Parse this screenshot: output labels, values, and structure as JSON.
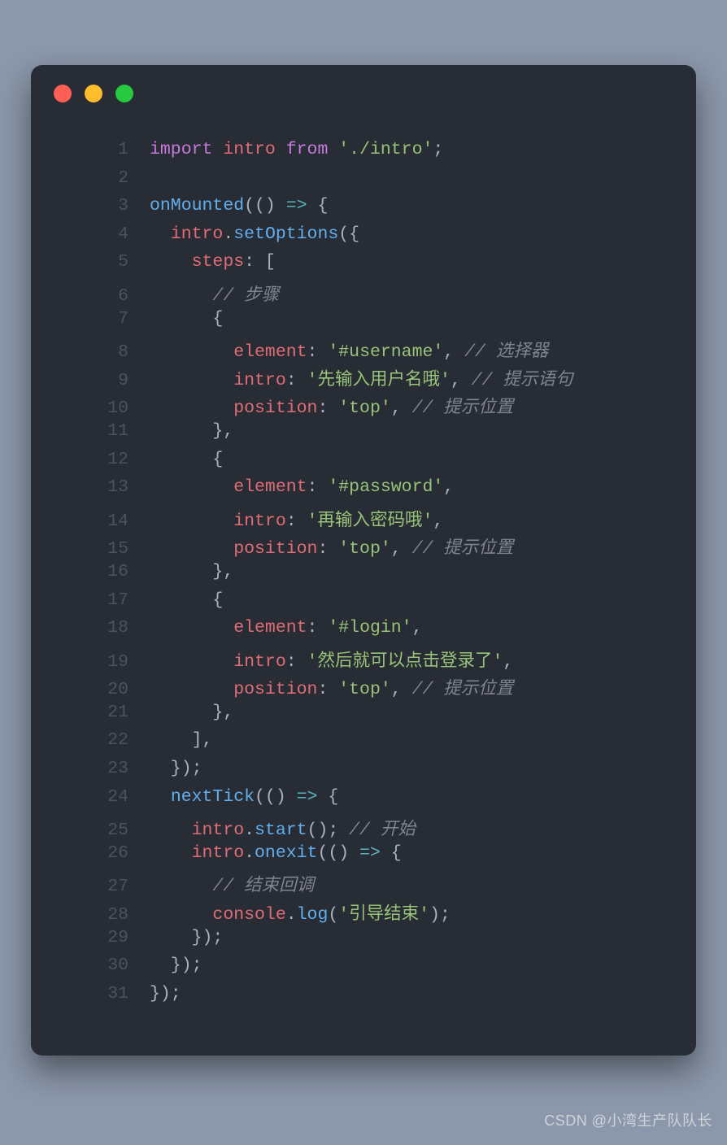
{
  "dots": {
    "red": "#ff5f56",
    "yellow": "#ffbd2e",
    "green": "#27c93f"
  },
  "watermark": "CSDN @小湾生产队队长",
  "lines": [
    {
      "n": "1",
      "seg": [
        [
          "kw",
          "import"
        ],
        [
          "pn",
          " "
        ],
        [
          "id",
          "intro"
        ],
        [
          "pn",
          " "
        ],
        [
          "kw",
          "from"
        ],
        [
          "pn",
          " "
        ],
        [
          "str",
          "'./intro'"
        ],
        [
          "pn",
          ";"
        ]
      ]
    },
    {
      "n": "2",
      "seg": []
    },
    {
      "n": "3",
      "seg": [
        [
          "fn",
          "onMounted"
        ],
        [
          "pn",
          "(() "
        ],
        [
          "op",
          "=>"
        ],
        [
          "pn",
          " {"
        ]
      ]
    },
    {
      "n": "4",
      "seg": [
        [
          "pn",
          "  "
        ],
        [
          "id",
          "intro"
        ],
        [
          "pn",
          "."
        ],
        [
          "fn",
          "setOptions"
        ],
        [
          "pn",
          "({"
        ]
      ]
    },
    {
      "n": "5",
      "seg": [
        [
          "pn",
          "    "
        ],
        [
          "prop",
          "steps"
        ],
        [
          "pn",
          ": ["
        ]
      ]
    },
    {
      "n": "6",
      "seg": [
        [
          "pn",
          "      "
        ],
        [
          "cm",
          "// 步骤"
        ]
      ]
    },
    {
      "n": "7",
      "seg": [
        [
          "pn",
          "      {"
        ]
      ]
    },
    {
      "n": "8",
      "seg": [
        [
          "pn",
          "        "
        ],
        [
          "prop",
          "element"
        ],
        [
          "pn",
          ": "
        ],
        [
          "str",
          "'#username'"
        ],
        [
          "pn",
          ", "
        ],
        [
          "cm",
          "// 选择器"
        ]
      ]
    },
    {
      "n": "9",
      "seg": [
        [
          "pn",
          "        "
        ],
        [
          "prop",
          "intro"
        ],
        [
          "pn",
          ": "
        ],
        [
          "str",
          "'先输入用户名哦'"
        ],
        [
          "pn",
          ", "
        ],
        [
          "cm",
          "// 提示语句"
        ]
      ]
    },
    {
      "n": "10",
      "seg": [
        [
          "pn",
          "        "
        ],
        [
          "prop",
          "position"
        ],
        [
          "pn",
          ": "
        ],
        [
          "str",
          "'top'"
        ],
        [
          "pn",
          ", "
        ],
        [
          "cm",
          "// 提示位置"
        ]
      ]
    },
    {
      "n": "11",
      "seg": [
        [
          "pn",
          "      },"
        ]
      ]
    },
    {
      "n": "12",
      "seg": [
        [
          "pn",
          "      {"
        ]
      ]
    },
    {
      "n": "13",
      "seg": [
        [
          "pn",
          "        "
        ],
        [
          "prop",
          "element"
        ],
        [
          "pn",
          ": "
        ],
        [
          "str",
          "'#password'"
        ],
        [
          "pn",
          ","
        ]
      ]
    },
    {
      "n": "14",
      "seg": [
        [
          "pn",
          "        "
        ],
        [
          "prop",
          "intro"
        ],
        [
          "pn",
          ": "
        ],
        [
          "str",
          "'再输入密码哦'"
        ],
        [
          "pn",
          ","
        ]
      ]
    },
    {
      "n": "15",
      "seg": [
        [
          "pn",
          "        "
        ],
        [
          "prop",
          "position"
        ],
        [
          "pn",
          ": "
        ],
        [
          "str",
          "'top'"
        ],
        [
          "pn",
          ", "
        ],
        [
          "cm",
          "// 提示位置"
        ]
      ]
    },
    {
      "n": "16",
      "seg": [
        [
          "pn",
          "      },"
        ]
      ]
    },
    {
      "n": "17",
      "seg": [
        [
          "pn",
          "      {"
        ]
      ]
    },
    {
      "n": "18",
      "seg": [
        [
          "pn",
          "        "
        ],
        [
          "prop",
          "element"
        ],
        [
          "pn",
          ": "
        ],
        [
          "str",
          "'#login'"
        ],
        [
          "pn",
          ","
        ]
      ]
    },
    {
      "n": "19",
      "seg": [
        [
          "pn",
          "        "
        ],
        [
          "prop",
          "intro"
        ],
        [
          "pn",
          ": "
        ],
        [
          "str",
          "'然后就可以点击登录了'"
        ],
        [
          "pn",
          ","
        ]
      ]
    },
    {
      "n": "20",
      "seg": [
        [
          "pn",
          "        "
        ],
        [
          "prop",
          "position"
        ],
        [
          "pn",
          ": "
        ],
        [
          "str",
          "'top'"
        ],
        [
          "pn",
          ", "
        ],
        [
          "cm",
          "// 提示位置"
        ]
      ]
    },
    {
      "n": "21",
      "seg": [
        [
          "pn",
          "      },"
        ]
      ]
    },
    {
      "n": "22",
      "seg": [
        [
          "pn",
          "    ],"
        ]
      ]
    },
    {
      "n": "23",
      "seg": [
        [
          "pn",
          "  });"
        ]
      ]
    },
    {
      "n": "24",
      "seg": [
        [
          "pn",
          "  "
        ],
        [
          "fn",
          "nextTick"
        ],
        [
          "pn",
          "(() "
        ],
        [
          "op",
          "=>"
        ],
        [
          "pn",
          " {"
        ]
      ]
    },
    {
      "n": "25",
      "seg": [
        [
          "pn",
          "    "
        ],
        [
          "id",
          "intro"
        ],
        [
          "pn",
          "."
        ],
        [
          "fn",
          "start"
        ],
        [
          "pn",
          "(); "
        ],
        [
          "cm",
          "// 开始"
        ]
      ]
    },
    {
      "n": "26",
      "seg": [
        [
          "pn",
          "    "
        ],
        [
          "id",
          "intro"
        ],
        [
          "pn",
          "."
        ],
        [
          "fn",
          "onexit"
        ],
        [
          "pn",
          "(() "
        ],
        [
          "op",
          "=>"
        ],
        [
          "pn",
          " {"
        ]
      ]
    },
    {
      "n": "27",
      "seg": [
        [
          "pn",
          "      "
        ],
        [
          "cm",
          "// 结束回调"
        ]
      ]
    },
    {
      "n": "28",
      "seg": [
        [
          "pn",
          "      "
        ],
        [
          "id",
          "console"
        ],
        [
          "pn",
          "."
        ],
        [
          "fn",
          "log"
        ],
        [
          "pn",
          "("
        ],
        [
          "str",
          "'引导结束'"
        ],
        [
          "pn",
          ");"
        ]
      ]
    },
    {
      "n": "29",
      "seg": [
        [
          "pn",
          "    });"
        ]
      ]
    },
    {
      "n": "30",
      "seg": [
        [
          "pn",
          "  });"
        ]
      ]
    },
    {
      "n": "31",
      "seg": [
        [
          "pn",
          "});"
        ]
      ]
    }
  ]
}
